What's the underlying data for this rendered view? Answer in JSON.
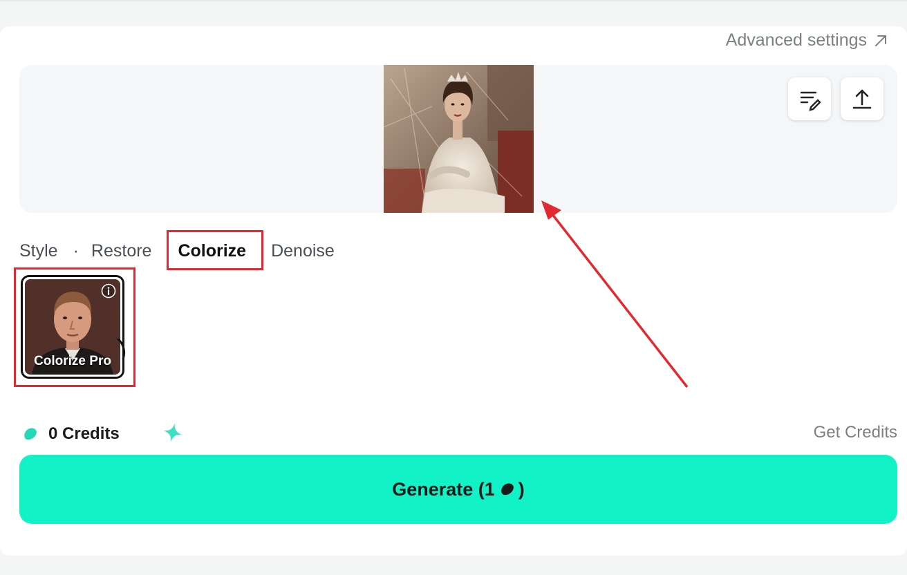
{
  "header": {
    "advanced_settings_label": "Advanced settings",
    "advanced_settings_icon": "arrow-up-right-icon"
  },
  "upload": {
    "edit_prompt_icon": "edit-list-icon",
    "upload_icon": "upload-icon",
    "image_subject": "vintage photo of a seated woman in a white dress and tiara"
  },
  "tabs": [
    {
      "label": "Style",
      "active": false
    },
    {
      "label": "Restore",
      "active": false
    },
    {
      "label": "Colorize",
      "active": true
    },
    {
      "label": "Denoise",
      "active": false
    }
  ],
  "tab_separator": "·",
  "models": [
    {
      "label": "Colorize Pro",
      "selected": true,
      "info_icon": "info-icon"
    }
  ],
  "footer": {
    "credits_label": "0 Credits",
    "credits_icon": "bean-icon",
    "get_credits_label": "Get Credits",
    "generate_label": "Generate (1",
    "generate_suffix": ")"
  },
  "colors": {
    "accent": "#12f2c7",
    "annotation_red": "#e02a2f"
  }
}
